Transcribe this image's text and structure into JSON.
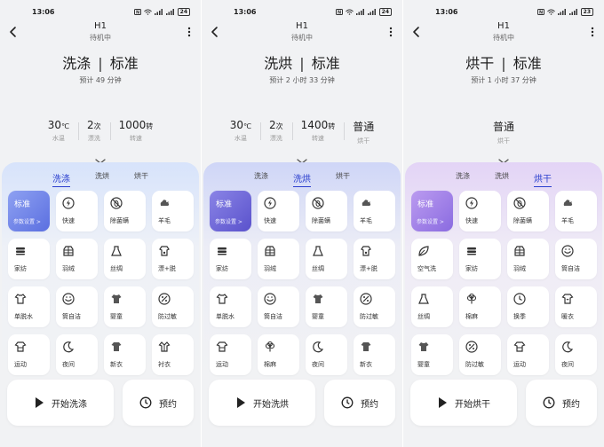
{
  "colors": {
    "accent_blue": "#2b3fcf",
    "tile_selected_1": "#5b6fe0",
    "tile_selected_2": "#5a52cc",
    "tile_selected_3": "#8a6be0"
  },
  "screens": [
    {
      "status": {
        "time": "13:06",
        "battery": "24"
      },
      "header": {
        "device": "H1",
        "state": "待机中"
      },
      "mode": {
        "left": "洗涤",
        "sep": "|",
        "right": "标准"
      },
      "estimate": "预计 49 分钟",
      "params": [
        {
          "value": "30",
          "unit": "℃",
          "label": "水温"
        },
        {
          "value": "2",
          "unit": "次",
          "label": "漂洗"
        },
        {
          "value": "1000",
          "unit": "转",
          "label": "转速"
        }
      ],
      "tabs": [
        {
          "label": "洗涤",
          "active": true
        },
        {
          "label": "洗烘"
        },
        {
          "label": "烘干"
        }
      ],
      "tiles": [
        {
          "name": "标准",
          "sub": "参数设置 >",
          "selected": true
        },
        {
          "name": "快速",
          "icon": "flash-icon"
        },
        {
          "name": "除菌螨",
          "icon": "no-bug-icon"
        },
        {
          "name": "羊毛",
          "icon": "wool-icon"
        },
        {
          "name": "家纺",
          "icon": "stack-icon"
        },
        {
          "name": "羽绒",
          "icon": "down-jacket-icon"
        },
        {
          "name": "丝绸",
          "icon": "dress-icon"
        },
        {
          "name": "漂+脱",
          "icon": "shirt-drop-icon"
        },
        {
          "name": "单脱水",
          "icon": "shirt-icon"
        },
        {
          "name": "筒自洁",
          "icon": "drum-clean-icon"
        },
        {
          "name": "婴童",
          "icon": "baby-clothes-icon"
        },
        {
          "name": "防过敏",
          "icon": "allergy-icon"
        },
        {
          "name": "运动",
          "icon": "sport-shirt-icon"
        },
        {
          "name": "夜间",
          "icon": "moon-icon"
        },
        {
          "name": "新衣",
          "icon": "new-shirt-icon"
        },
        {
          "name": "衬衣",
          "icon": "dress-shirt-icon"
        }
      ],
      "buttons": {
        "start": "开始洗涤",
        "schedule": "预约"
      }
    },
    {
      "status": {
        "time": "13:06",
        "battery": "24"
      },
      "header": {
        "device": "H1",
        "state": "待机中"
      },
      "mode": {
        "left": "洗烘",
        "sep": "|",
        "right": "标准"
      },
      "estimate": "预计 2 小时 33 分钟",
      "params": [
        {
          "value": "30",
          "unit": "℃",
          "label": "水温"
        },
        {
          "value": "2",
          "unit": "次",
          "label": "漂洗"
        },
        {
          "value": "1400",
          "unit": "转",
          "label": "转速"
        },
        {
          "value": "普通",
          "unit": "",
          "label": "烘干"
        }
      ],
      "tabs": [
        {
          "label": "洗涤"
        },
        {
          "label": "洗烘",
          "active": true
        },
        {
          "label": "烘干"
        }
      ],
      "tiles": [
        {
          "name": "标准",
          "sub": "参数设置 >",
          "selected": true
        },
        {
          "name": "快速",
          "icon": "flash-icon"
        },
        {
          "name": "除菌螨",
          "icon": "no-bug-icon"
        },
        {
          "name": "羊毛",
          "icon": "wool-icon"
        },
        {
          "name": "家纺",
          "icon": "stack-icon"
        },
        {
          "name": "羽绒",
          "icon": "down-jacket-icon"
        },
        {
          "name": "丝绸",
          "icon": "dress-icon"
        },
        {
          "name": "漂+脱",
          "icon": "shirt-drop-icon"
        },
        {
          "name": "单脱水",
          "icon": "shirt-icon"
        },
        {
          "name": "筒自洁",
          "icon": "drum-clean-icon"
        },
        {
          "name": "婴童",
          "icon": "baby-clothes-icon"
        },
        {
          "name": "防过敏",
          "icon": "allergy-icon"
        },
        {
          "name": "运动",
          "icon": "sport-shirt-icon"
        },
        {
          "name": "棉麻",
          "icon": "cotton-icon"
        },
        {
          "name": "夜间",
          "icon": "moon-icon"
        },
        {
          "name": "新衣",
          "icon": "new-shirt-icon"
        }
      ],
      "buttons": {
        "start": "开始洗烘",
        "schedule": "预约"
      }
    },
    {
      "status": {
        "time": "13:06",
        "battery": "23"
      },
      "header": {
        "device": "H1",
        "state": "待机中"
      },
      "mode": {
        "left": "烘干",
        "sep": "|",
        "right": "标准"
      },
      "estimate": "预计 1 小时 37 分钟",
      "params": [
        {
          "value": "普通",
          "unit": "",
          "label": "烘干"
        }
      ],
      "tabs": [
        {
          "label": "洗涤"
        },
        {
          "label": "洗烘"
        },
        {
          "label": "烘干",
          "active": true
        }
      ],
      "tiles": [
        {
          "name": "标准",
          "sub": "参数设置 >",
          "selected": true
        },
        {
          "name": "快速",
          "icon": "flash-icon"
        },
        {
          "name": "除菌螨",
          "icon": "no-bug-icon"
        },
        {
          "name": "羊毛",
          "icon": "wool-icon"
        },
        {
          "name": "空气洗",
          "icon": "leaf-icon"
        },
        {
          "name": "家纺",
          "icon": "stack-icon"
        },
        {
          "name": "羽绒",
          "icon": "down-jacket-icon"
        },
        {
          "name": "筒自洁",
          "icon": "drum-clean-icon"
        },
        {
          "name": "丝绸",
          "icon": "dress-icon"
        },
        {
          "name": "棉麻",
          "icon": "cotton-icon"
        },
        {
          "name": "换季",
          "icon": "clock-icon"
        },
        {
          "name": "暖衣",
          "icon": "warm-shirt-icon"
        },
        {
          "name": "婴童",
          "icon": "baby-clothes-icon"
        },
        {
          "name": "防过敏",
          "icon": "allergy-icon"
        },
        {
          "name": "运动",
          "icon": "sport-shirt-icon"
        },
        {
          "name": "夜间",
          "icon": "moon-icon"
        }
      ],
      "buttons": {
        "start": "开始烘干",
        "schedule": "预约"
      }
    }
  ]
}
